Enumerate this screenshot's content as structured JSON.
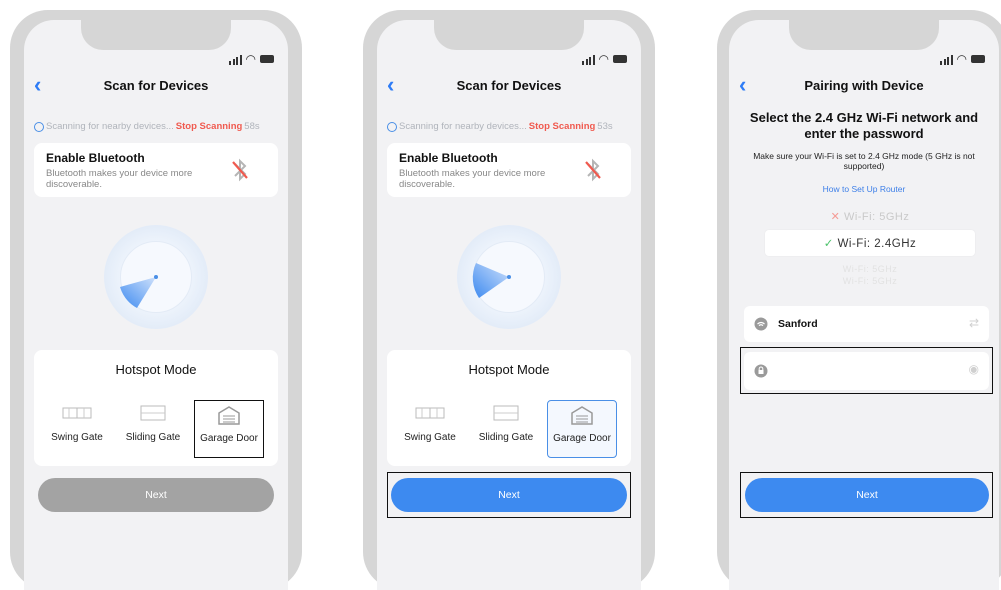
{
  "phones": [
    {
      "title": "Scan for Devices",
      "scan_text": "Scanning for nearby devices...",
      "stop_label": "Stop Scanning",
      "countdown": "58s",
      "bluetooth": {
        "title": "Enable Bluetooth",
        "desc": "Bluetooth makes your device more discoverable."
      },
      "hotspot_title": "Hotspot Mode",
      "options": [
        "Swing Gate",
        "Sliding Gate",
        "Garage Door"
      ],
      "next_label": "Next"
    },
    {
      "title": "Scan for Devices",
      "scan_text": "Scanning for nearby devices...",
      "stop_label": "Stop Scanning",
      "countdown": "53s",
      "bluetooth": {
        "title": "Enable Bluetooth",
        "desc": "Bluetooth makes your device more discoverable."
      },
      "hotspot_title": "Hotspot Mode",
      "options": [
        "Swing Gate",
        "Sliding Gate",
        "Garage Door"
      ],
      "next_label": "Next"
    },
    {
      "title": "Pairing with Device",
      "heading": "Select the 2.4 GHz Wi-Fi network and enter the password",
      "subtext": "Make sure your Wi-Fi is set to 2.4 GHz mode (5 GHz is not supported)",
      "router_link": "How to Set Up Router",
      "wifi_modes": [
        "Wi-Fi: 5GHz",
        "Wi-Fi: 2.4GHz",
        "Wi-Fi: 5GHz",
        "Wi-Fi: 5GHz"
      ],
      "network_name": "Sanford",
      "next_label": "Next"
    }
  ],
  "colors": {
    "accent": "#3d8af0",
    "stop": "#f05a4f",
    "disabled": "#a3a3a3"
  }
}
